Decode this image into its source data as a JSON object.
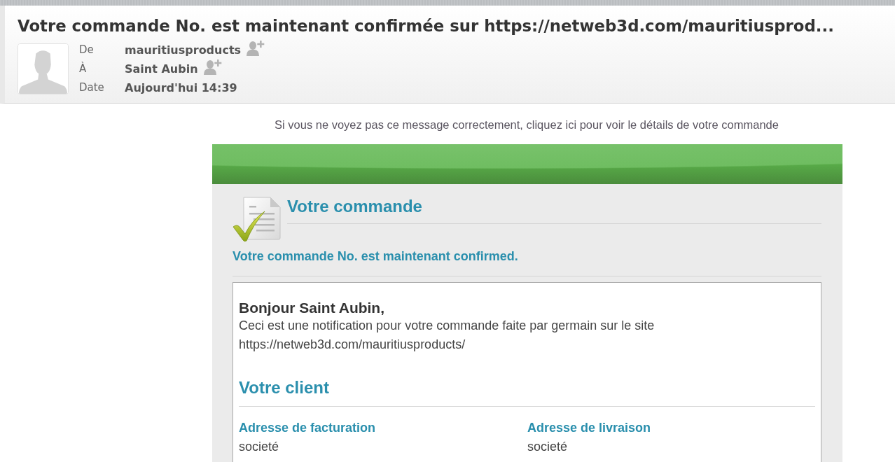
{
  "message": {
    "subject": "Votre commande No. est maintenant confirmée sur https://netweb3d.com/mauritiusprod...",
    "fields": [
      {
        "label": "De",
        "value": "mauritiusproducts",
        "add_contact": true
      },
      {
        "label": "À",
        "value": "Saint Aubin",
        "add_contact": true
      },
      {
        "label": "Date",
        "value": "Aujourd'hui 14:39",
        "add_contact": false
      }
    ]
  },
  "email_body": {
    "view_notice": "Si vous ne voyez pas ce message correctement, cliquez ici pour voir le détails de votre commande",
    "order_heading": "Votre commande",
    "confirmation": "Votre commande No. est maintenant confirmed.",
    "greeting": "Bonjour Saint Aubin,",
    "intro": "Ceci est une notification pour votre commande faite par germain sur le site",
    "site_url": "https://netweb3d.com/mauritiusproducts/",
    "client_heading": "Votre client",
    "addresses": [
      {
        "heading": "Adresse de facturation",
        "lines": [
          "societé"
        ]
      },
      {
        "heading": "Adresse de livraison",
        "lines": [
          "societé"
        ]
      }
    ]
  }
}
